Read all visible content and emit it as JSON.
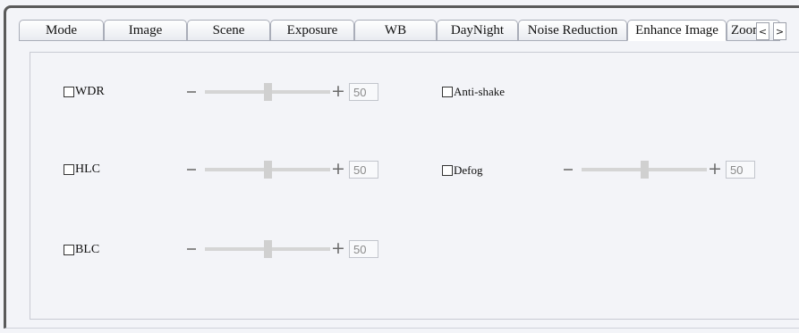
{
  "tabs": [
    {
      "label": "Mode",
      "active": false
    },
    {
      "label": "Image",
      "active": false
    },
    {
      "label": "Scene",
      "active": false
    },
    {
      "label": "Exposure",
      "active": false
    },
    {
      "label": "WB",
      "active": false
    },
    {
      "label": "DayNight",
      "active": false
    },
    {
      "label": "Noise Reduction",
      "active": false
    },
    {
      "label": "Enhance Image",
      "active": true
    },
    {
      "label": "Zoom",
      "active": false
    }
  ],
  "nav": {
    "prev": "<",
    "next": ">"
  },
  "options": {
    "wdr": {
      "label": "WDR",
      "checked": false,
      "value": "50",
      "level": 50
    },
    "anti_shake": {
      "label": "Anti-shake",
      "checked": false
    },
    "hlc": {
      "label": "HLC",
      "checked": false,
      "value": "50",
      "level": 50
    },
    "defog": {
      "label": "Defog",
      "checked": false,
      "value": "50",
      "level": 50
    },
    "blc": {
      "label": "BLC",
      "checked": false,
      "value": "50",
      "level": 50
    }
  }
}
